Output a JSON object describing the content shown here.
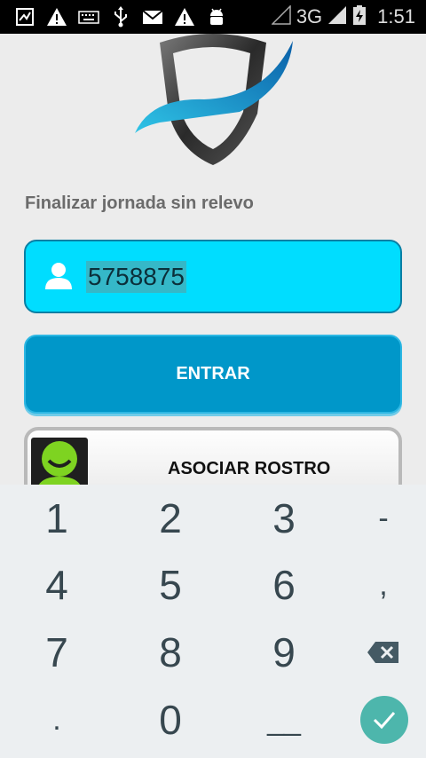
{
  "status_bar": {
    "network_label": "3G",
    "time": "1:51",
    "icons": [
      "screenshot-icon",
      "warning-icon",
      "keyboard-icon",
      "usb-icon",
      "mail-icon",
      "warning-icon",
      "android-icon",
      "signal-icon",
      "battery-icon"
    ]
  },
  "screen": {
    "subtitle": "Finalizar jornada sin relevo",
    "id_input": {
      "value": "5758875",
      "icon": "user-icon"
    },
    "enter_button": {
      "label": "ENTRAR"
    },
    "face_button": {
      "label": "ASOCIAR ROSTRO",
      "icon": "face-icon"
    }
  },
  "keyboard": {
    "keys": [
      {
        "label": "1"
      },
      {
        "label": "2"
      },
      {
        "label": "3"
      },
      {
        "label": "-"
      },
      {
        "label": "4"
      },
      {
        "label": "5"
      },
      {
        "label": "6"
      },
      {
        "label": ","
      },
      {
        "label": "7"
      },
      {
        "label": "8"
      },
      {
        "label": "9"
      },
      {
        "label": "."
      },
      {
        "label": "0"
      },
      {
        "label": "__"
      }
    ],
    "backspace_icon": "backspace-icon",
    "done_icon": "check-icon"
  },
  "colors": {
    "input_bg": "#00ddff",
    "button_bg": "#0097c9",
    "keyboard_bg": "#eceff1",
    "done_bg": "#4db6ac"
  }
}
